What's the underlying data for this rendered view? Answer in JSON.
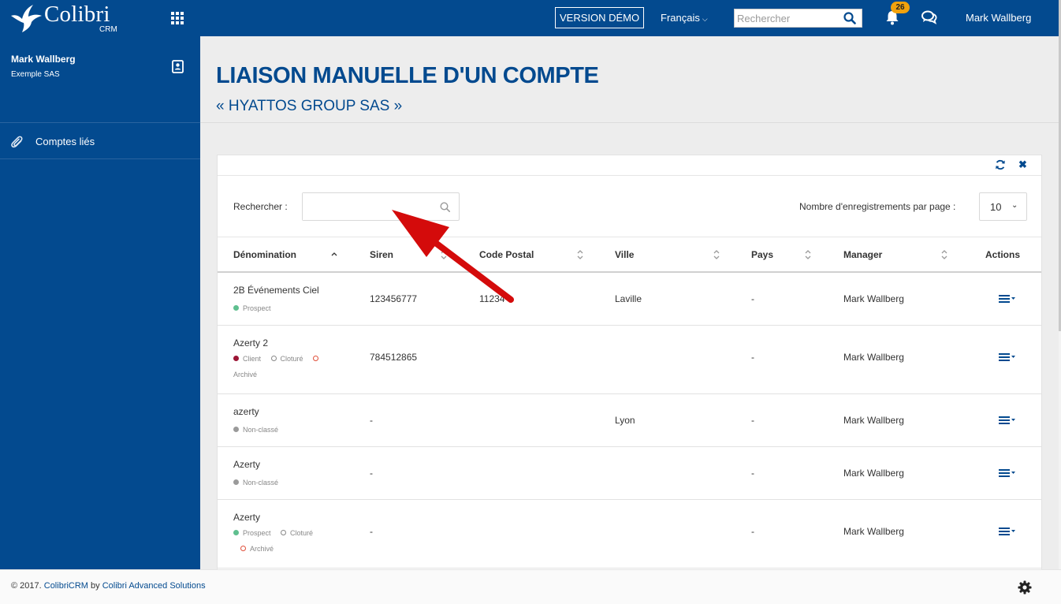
{
  "colors": {
    "brand": "#034a8f",
    "badge": "#f1a20d",
    "arrow": "#d40b0b",
    "prospect": "#5fbf8f",
    "client": "#9c1535",
    "non_classe": "#9a9a9a",
    "cloture": "#888888",
    "archive": "#e04e39"
  },
  "app": {
    "logo_name": "Colibri",
    "logo_sub": "CRM"
  },
  "topbar": {
    "demo_label": "VERSION DÉMO",
    "language": "Français",
    "search_placeholder": "Rechercher",
    "notifications_count": "26",
    "user": "Mark Wallberg"
  },
  "sidebar": {
    "user_name": "Mark Wallberg",
    "company": "Exemple SAS",
    "items": [
      {
        "label": "Comptes liés",
        "icon": "paperclip-icon"
      }
    ]
  },
  "page": {
    "title": "LIAISON MANUELLE D'UN COMPTE",
    "subtitle": "« HYATTOS GROUP SAS »"
  },
  "table": {
    "search_label": "Rechercher :",
    "search_value": "",
    "per_page_label": "Nombre d'enregistrements par page :",
    "per_page_value": "10",
    "columns": [
      "Dénomination",
      "Siren",
      "Code Postal",
      "Ville",
      "Pays",
      "Manager",
      "Actions"
    ],
    "rows": [
      {
        "name": "2B Événements Ciel",
        "statuses": [
          {
            "label": "Prospect",
            "kind": "prospect"
          }
        ],
        "siren": "123456777",
        "code_postal": "11234",
        "ville": "Laville",
        "pays": "-",
        "manager": "Mark Wallberg"
      },
      {
        "name": "Azerty 2",
        "statuses": [
          {
            "label": "Client",
            "kind": "client"
          },
          {
            "label": "Cloturé",
            "kind": "cloture"
          },
          {
            "label": "Archivé",
            "kind": "archive"
          }
        ],
        "siren": "784512865",
        "code_postal": "",
        "ville": "",
        "pays": "-",
        "manager": "Mark Wallberg"
      },
      {
        "name": "azerty",
        "statuses": [
          {
            "label": "Non-classé",
            "kind": "non_classe"
          }
        ],
        "siren": "-",
        "code_postal": "",
        "ville": "Lyon",
        "pays": "-",
        "manager": "Mark Wallberg"
      },
      {
        "name": "Azerty",
        "statuses": [
          {
            "label": "Non-classé",
            "kind": "non_classe"
          }
        ],
        "siren": "-",
        "code_postal": "",
        "ville": "",
        "pays": "-",
        "manager": "Mark Wallberg"
      },
      {
        "name": "Azerty",
        "statuses": [
          {
            "label": "Prospect",
            "kind": "prospect"
          },
          {
            "label": "Cloturé",
            "kind": "cloture"
          },
          {
            "label": "Archivé",
            "kind": "archive"
          }
        ],
        "siren": "-",
        "code_postal": "",
        "ville": "",
        "pays": "-",
        "manager": "Mark Wallberg"
      }
    ]
  },
  "footer": {
    "prefix": "© 2017. ",
    "link1": "ColibriCRM",
    "middle": " by ",
    "link2": "Colibri Advanced Solutions"
  }
}
